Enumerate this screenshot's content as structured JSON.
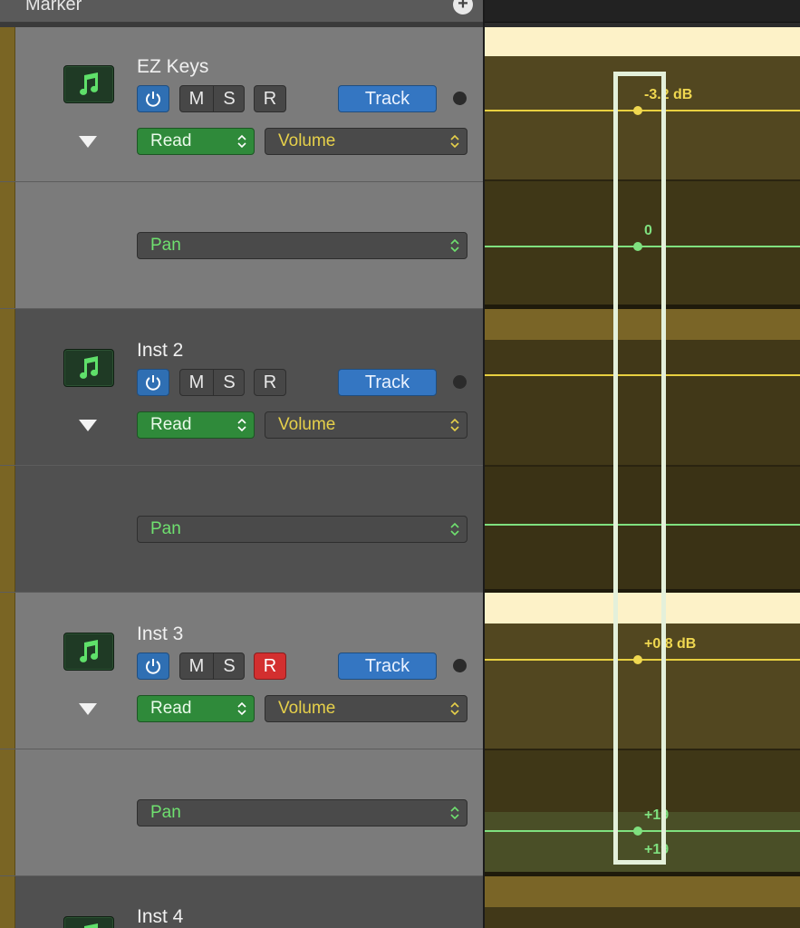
{
  "header": {
    "marker_label": "Marker",
    "add_icon": "plus-icon"
  },
  "tracks": [
    {
      "name": "EZ Keys",
      "buttons": {
        "mute": "M",
        "solo": "S",
        "record": "R",
        "track": "Track"
      },
      "automation_mode": "Read",
      "parameter": "Volume",
      "pan_parameter": "Pan",
      "volume_value": "-3.2 dB",
      "pan_value": "0",
      "record_armed": false
    },
    {
      "name": "Inst 2",
      "buttons": {
        "mute": "M",
        "solo": "S",
        "record": "R",
        "track": "Track"
      },
      "automation_mode": "Read",
      "parameter": "Volume",
      "pan_parameter": "Pan",
      "record_armed": false
    },
    {
      "name": "Inst 3",
      "buttons": {
        "mute": "M",
        "solo": "S",
        "record": "R",
        "track": "Track"
      },
      "automation_mode": "Read",
      "parameter": "Volume",
      "pan_parameter": "Pan",
      "volume_value": "+0.8 dB",
      "pan_value_top": "+19",
      "pan_value_bottom": "+19",
      "record_armed": true
    },
    {
      "name": "Inst 4"
    }
  ],
  "colors": {
    "accent_blue": "#3476c2",
    "read_green": "#2f8a3a",
    "record_red": "#d32f2f",
    "volume_yellow": "#e8d040",
    "pan_green": "#7fe07f"
  }
}
